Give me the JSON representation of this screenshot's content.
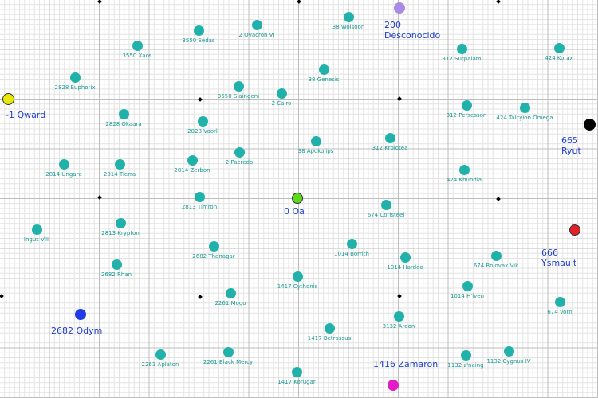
{
  "planets": [
    {
      "label": "38 Wolsoon"
    },
    {
      "label": "2 Ovacron VI"
    },
    {
      "label": "3550 Sedas"
    },
    {
      "label": "3550 Xaos"
    },
    {
      "label": "312 Surpalam"
    },
    {
      "label": "424 Korax"
    },
    {
      "label": "38 Genesis"
    },
    {
      "label": "2828 Euphorix"
    },
    {
      "label": "3550 Slaingeni"
    },
    {
      "label": "2 Cairo"
    },
    {
      "label": "312 Persesson"
    },
    {
      "label": "424 Talcyion Omega"
    },
    {
      "label": "2828 Okaara"
    },
    {
      "label": "2828 Voorl"
    },
    {
      "label": "38 Apokolips"
    },
    {
      "label": "312 Krolotea"
    },
    {
      "label": "2814 Tierra"
    },
    {
      "label": "2814 Ungara"
    },
    {
      "label": "2814 Zerbon"
    },
    {
      "label": "2 Pacredo"
    },
    {
      "label": "424 Khundia"
    },
    {
      "label": "2813 Timron"
    },
    {
      "label": "2813 Krypton"
    },
    {
      "label": "Ingus VIII"
    },
    {
      "label": "674 Corlsteel"
    },
    {
      "label": "2682 Thanagar"
    },
    {
      "label": "1014 Borrith"
    },
    {
      "label": "674 Bolovax Vik"
    },
    {
      "label": "1014 Hardeo"
    },
    {
      "label": "2682 Rhan"
    },
    {
      "label": "1417 Cythonis"
    },
    {
      "label": "1014 H'lven"
    },
    {
      "label": "674 Vorn"
    },
    {
      "label": "2261 Mogo"
    },
    {
      "label": "3132 Ardon"
    },
    {
      "label": "1417 Betrassus"
    },
    {
      "label": "2261 Aplaton"
    },
    {
      "label": "2261 Black Mercy"
    },
    {
      "label": "1132 Cygnus IV"
    },
    {
      "label": "1132 z'naing"
    },
    {
      "label": "1417 Korugar"
    }
  ],
  "special": [
    {
      "label1": "200",
      "label2": "Desconocido",
      "color": "#a98be6",
      "name": "planet-desconocido"
    },
    {
      "label1": "-1 Qward",
      "label2": "",
      "color": "#e8e80a",
      "name": "planet-qward"
    },
    {
      "label1": "665",
      "label2": "Ryut",
      "color": "#000000",
      "name": "planet-ryut"
    },
    {
      "label1": "0 Oa",
      "label2": "",
      "color": "#5ed81f",
      "name": "planet-oa"
    },
    {
      "label1": "666",
      "label2": "Ysmault",
      "color": "#e0202a",
      "name": "planet-ysmault"
    },
    {
      "label1": "2682 Odym",
      "label2": "",
      "color": "#1f3ae6",
      "name": "planet-odym"
    },
    {
      "label1": "1416 Zamaron",
      "label2": "",
      "color": "#e21cc9",
      "name": "planet-zamaron"
    }
  ]
}
